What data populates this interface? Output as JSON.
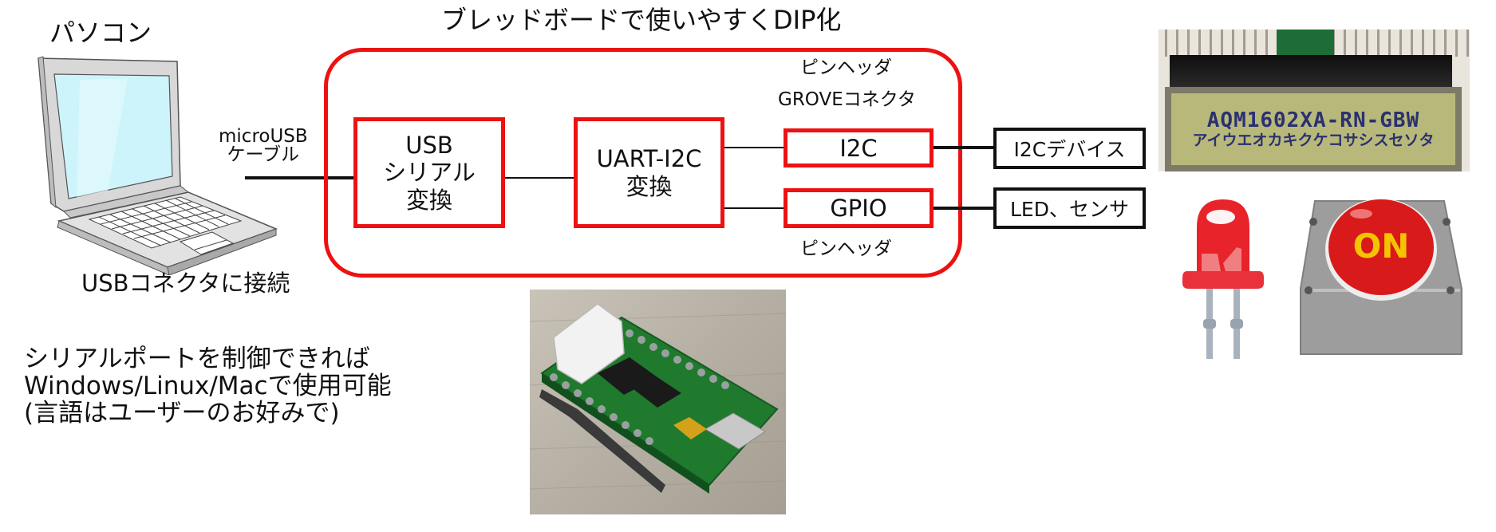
{
  "diagram": {
    "title": "ブレッドボードで使いやすくDIP化",
    "pc": {
      "label": "パソコン",
      "cable_label_line1": "microUSB",
      "cable_label_line2": "ケーブル",
      "connector_note": "USBコネクタに接続"
    },
    "blocks": {
      "usb_serial": [
        "USB",
        "シリアル",
        "変換"
      ],
      "uart_i2c": [
        "UART-I2C",
        "変換"
      ],
      "i2c": "I2C",
      "gpio": "GPIO"
    },
    "annotations": {
      "i2c_header_line1": "ピンヘッダ",
      "i2c_header_line2": "GROVEコネクタ",
      "gpio_header": "ピンヘッダ"
    },
    "devices": {
      "i2c_device": "I2Cデバイス",
      "gpio_device": "LED、センサ"
    },
    "notes": [
      "シリアルポートを制御できれば",
      "Windows/Linux/Macで使用可能",
      "(言語はユーザーのお好みで)"
    ],
    "lcd": {
      "line1": "AQM1602XA-RN-GBW",
      "line2": "アイウエオカキクケコサシスセソタ"
    },
    "button": {
      "label": "ON"
    },
    "colors": {
      "block_border": "#ee1111",
      "line": "#111111",
      "lcd_text": "#2a3170",
      "lcd_bg": "#b8b87a",
      "button_red": "#d81a1a",
      "button_text": "#f5c400"
    }
  }
}
